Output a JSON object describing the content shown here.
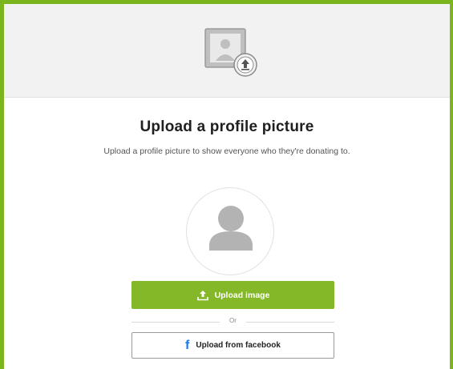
{
  "header": {
    "icon": "upload-photo-icon"
  },
  "content": {
    "title": "Upload a profile picture",
    "subtitle": "Upload a profile picture to show everyone who they're donating to."
  },
  "avatar": {
    "icon": "user-silhouette-icon"
  },
  "actions": {
    "upload_image_label": "Upload image",
    "upload_icon": "upload-arrow-icon",
    "divider_text": "Or",
    "facebook_label": "Upload from facebook",
    "facebook_icon": "facebook-f-icon"
  },
  "colors": {
    "accent_green": "#84b828",
    "frame_green": "#7ab51d",
    "facebook_blue": "#1877f2",
    "header_bg": "#f2f2f2"
  }
}
